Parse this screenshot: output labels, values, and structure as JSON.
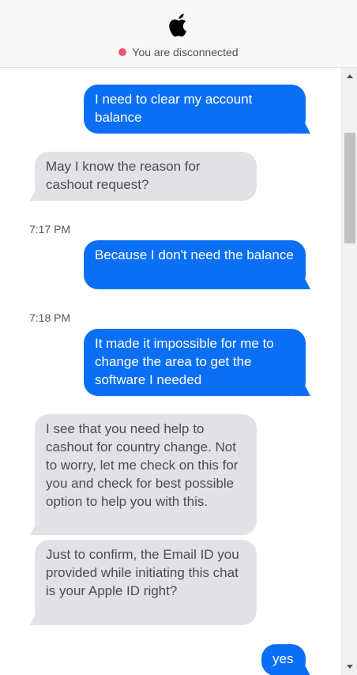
{
  "header": {
    "logo_icon": "apple-logo-icon",
    "status_text": "You are disconnected",
    "status_color": "#ee5775"
  },
  "messages": [
    {
      "from": "user",
      "text": "I need to clear my account balance"
    },
    {
      "from": "agent",
      "text": "May I know the reason for cashout request?"
    },
    {
      "timestamp": "7:17 PM"
    },
    {
      "from": "user",
      "text": "Because I don't need the balance"
    },
    {
      "timestamp": "7:18 PM"
    },
    {
      "from": "user",
      "text": "It made it impossible for me to change the area to get the software I needed"
    },
    {
      "from": "agent",
      "text": "I see that you need help to cashout for country change. Not to worry, let me check on this for you and check for best possible option to help you with this."
    },
    {
      "from": "agent",
      "text": "Just to confirm, the Email ID you provided while initiating this chat is your Apple ID right?"
    },
    {
      "from": "user",
      "text": "yes"
    }
  ],
  "colors": {
    "sent_bubble": "#0b6ff5",
    "received_bubble": "#e1e1e6"
  }
}
